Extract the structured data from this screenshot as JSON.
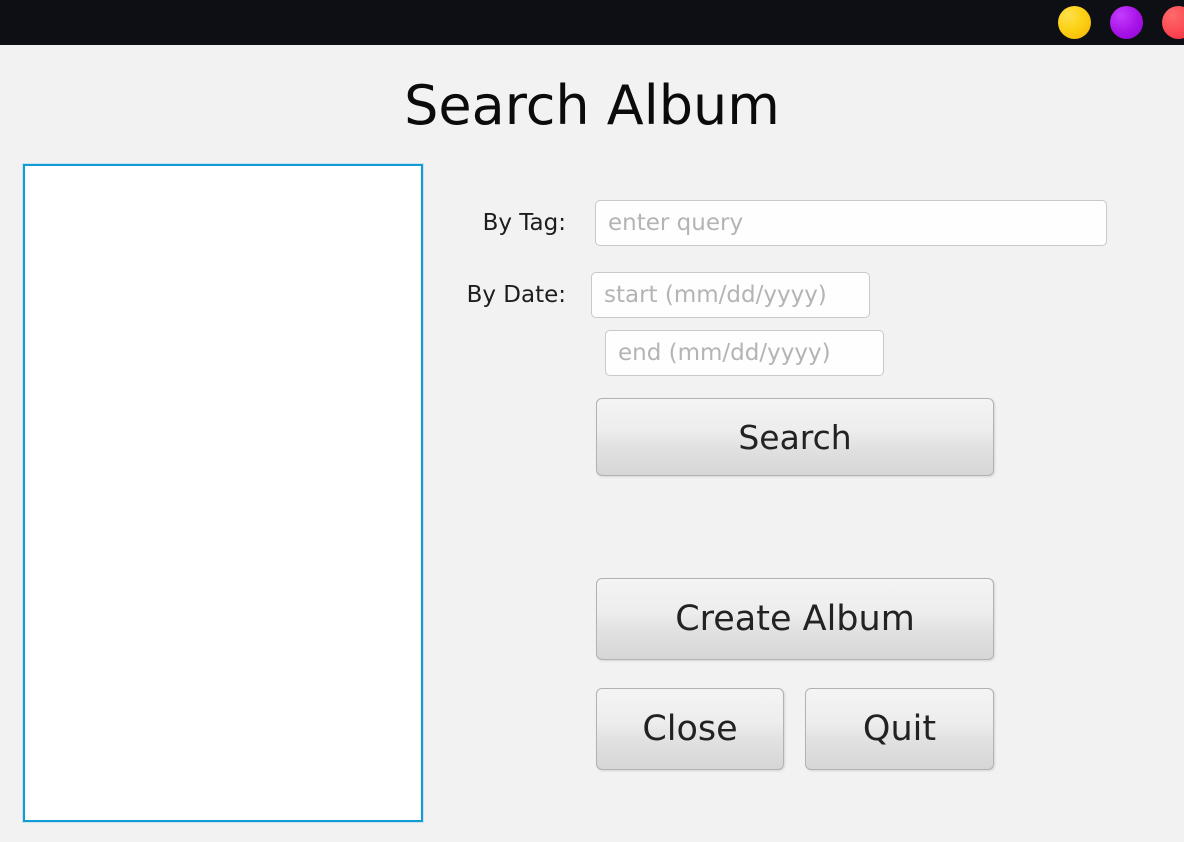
{
  "window": {
    "controls": [
      {
        "name": "minimize-button",
        "color": "#fcd116"
      },
      {
        "name": "maximize-button",
        "color": "#aa16e8"
      },
      {
        "name": "close-window-button",
        "color": "#fb4b55"
      }
    ]
  },
  "header": {
    "title": "Search Album"
  },
  "results": {
    "items": []
  },
  "form": {
    "tag": {
      "label": "By Tag:",
      "value": "",
      "placeholder": "enter query"
    },
    "date": {
      "label": "By Date:",
      "start": {
        "value": "",
        "placeholder": "start (mm/dd/yyyy)"
      },
      "end": {
        "value": "",
        "placeholder": "end (mm/dd/yyyy)"
      }
    }
  },
  "buttons": {
    "search": "Search",
    "create_album": "Create Album",
    "close": "Close",
    "quit": "Quit"
  },
  "colors": {
    "accent_border": "#129bd4",
    "background": "#f2f2f2",
    "titlebar": "#0d0f14"
  }
}
